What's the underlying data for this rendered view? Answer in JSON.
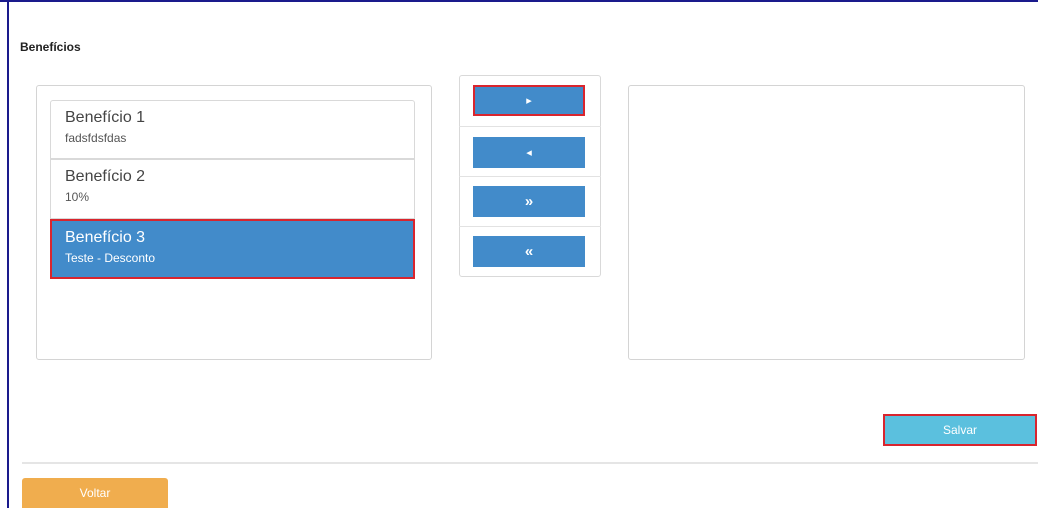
{
  "section_title": "Benefícios",
  "available_list": {
    "items": [
      {
        "title": "Benefício 1",
        "subtitle": "fadsfdsfdas",
        "selected": false
      },
      {
        "title": "Benefício 2",
        "subtitle": "10%",
        "selected": false
      },
      {
        "title": "Benefício 3",
        "subtitle": "Teste - Desconto",
        "selected": true
      }
    ]
  },
  "selected_list": {
    "items": []
  },
  "transfer_buttons": {
    "move_right_icon": "▸",
    "move_left_icon": "◂",
    "move_all_right_icon": "»",
    "move_all_left_icon": "«"
  },
  "actions": {
    "save_label": "Salvar",
    "back_label": "Voltar"
  },
  "colors": {
    "primary": "#428bca",
    "info": "#5bc0de",
    "warning": "#f0ad4e",
    "highlight": "#d9252e"
  }
}
